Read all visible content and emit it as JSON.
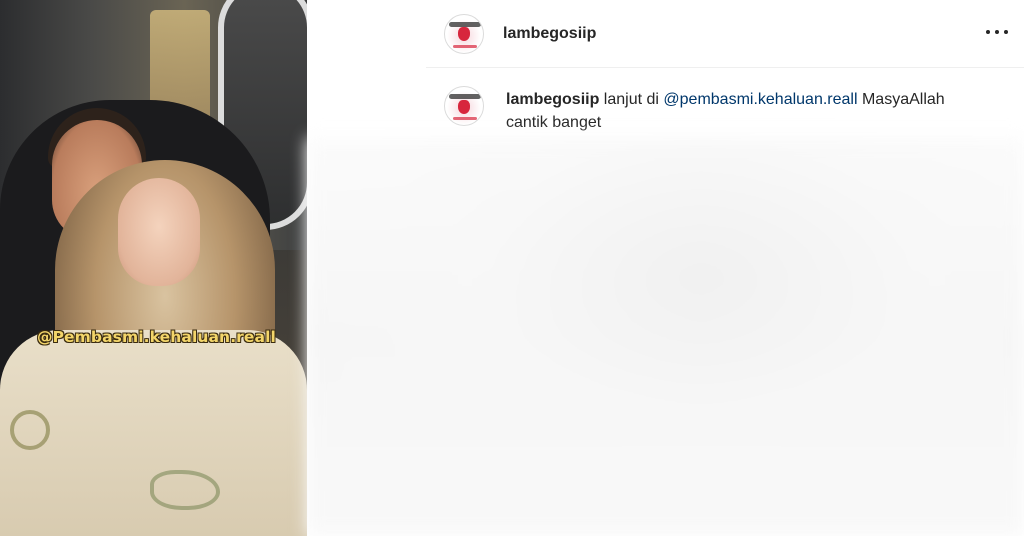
{
  "post": {
    "username": "lambegosiip",
    "more_icon": "more-horizontal-icon"
  },
  "media": {
    "watermark": "@Pembasmi.kehaluan.reall"
  },
  "caption": {
    "username": "lambegosiip",
    "text_before": " lanjut di ",
    "mention": "@pembasmi.kehaluan.reall",
    "text_after": " MasyaAllah cantik banget"
  },
  "colors": {
    "text": "#262626",
    "mention": "#00376b",
    "divider": "#efefef",
    "watermark": "#f3d56a"
  }
}
